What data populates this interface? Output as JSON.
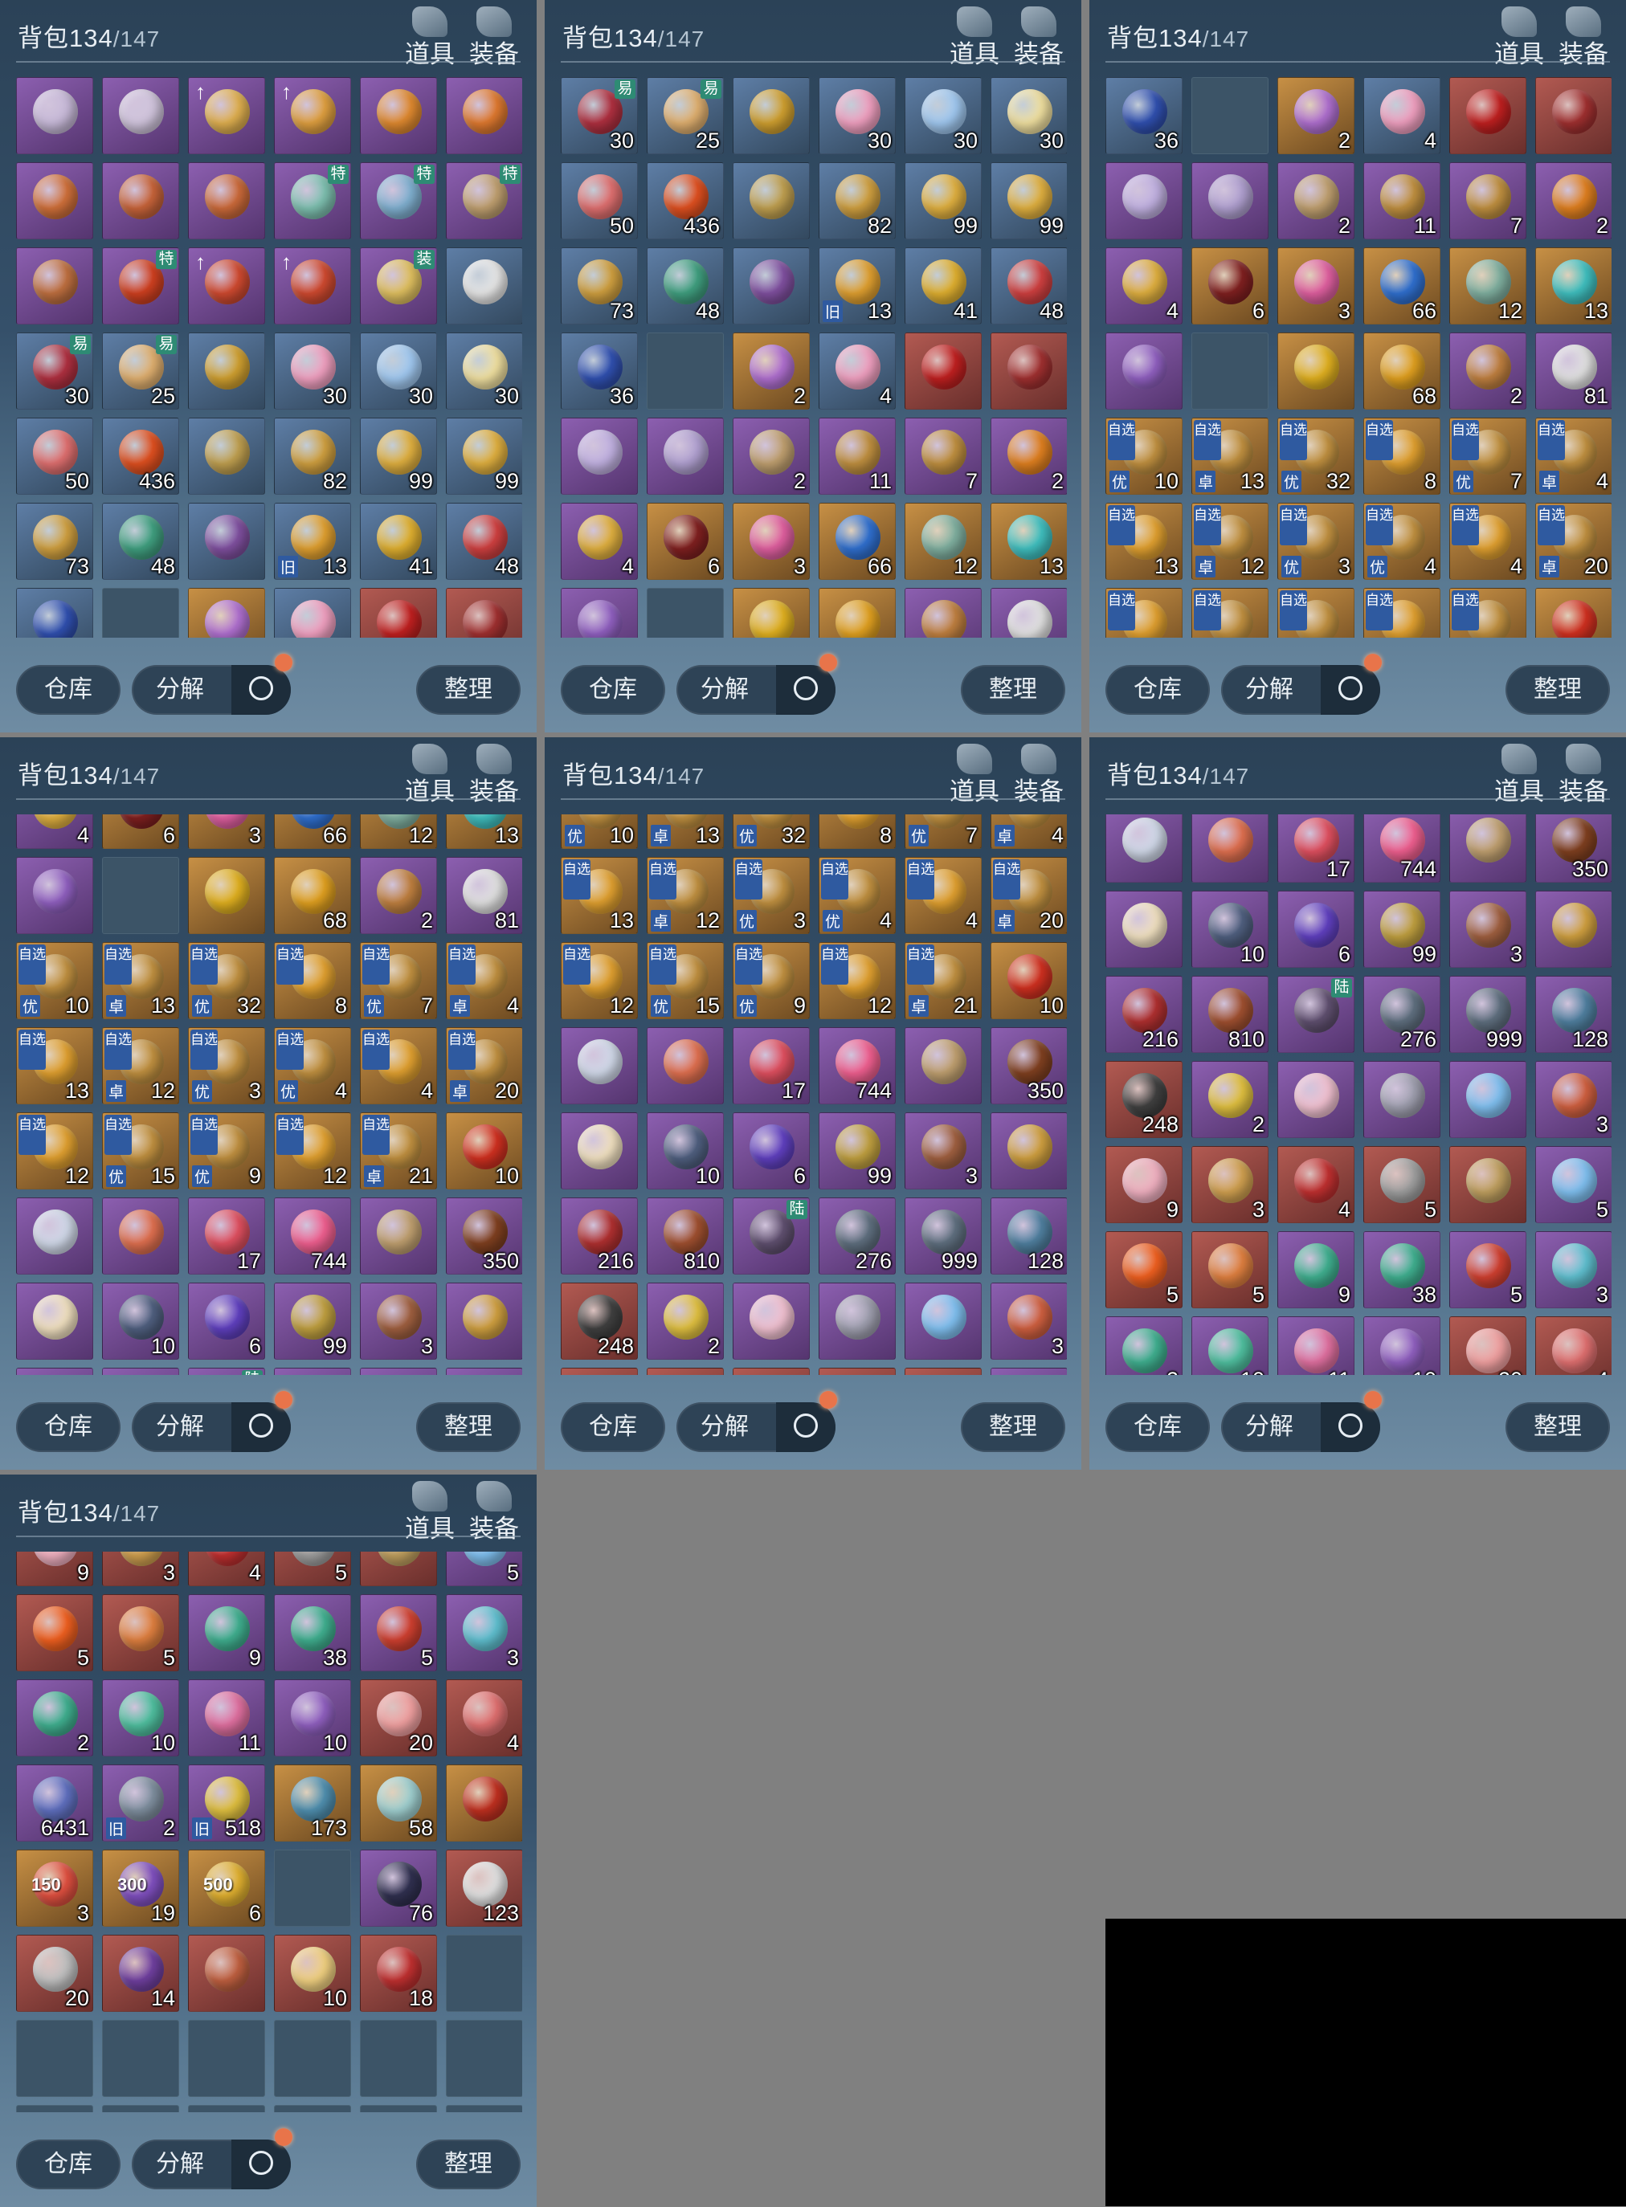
{
  "header": {
    "title": "背包",
    "count": "134",
    "capacity": "/147"
  },
  "tabs": [
    {
      "label": "道具",
      "icon": "bag-tools-icon"
    },
    {
      "label": "装备",
      "icon": "bag-equipment-icon"
    }
  ],
  "buttons": {
    "warehouse": "仓库",
    "decompose": "分解",
    "sort": "整理"
  },
  "colors": {
    "purple": "#7a4fa0",
    "gold": "#b8843e",
    "red": "#9e4a44",
    "blue": "#4c6b91",
    "empty": "#3c5467",
    "panel": "#35506a"
  },
  "inventory": [
    {
      "q": "purple",
      "c": "",
      "color": "#c7b9d8"
    },
    {
      "q": "purple",
      "c": "",
      "color": "#d0c4dc"
    },
    {
      "q": "purple",
      "c": "",
      "color": "#e0b050",
      "up": "1"
    },
    {
      "q": "purple",
      "c": "",
      "color": "#e0a040",
      "up": "1"
    },
    {
      "q": "purple",
      "c": "",
      "color": "#e08a30"
    },
    {
      "q": "purple",
      "c": "",
      "color": "#e07a30"
    },
    {
      "q": "purple",
      "c": "",
      "color": "#d0703a"
    },
    {
      "q": "purple",
      "c": "",
      "color": "#c8643a"
    },
    {
      "q": "purple",
      "c": "",
      "color": "#cc6a3a"
    },
    {
      "q": "purple",
      "c": "",
      "color": "#7ec0b0",
      "tag": "特"
    },
    {
      "q": "purple",
      "c": "",
      "color": "#80b0d0",
      "tag": "特"
    },
    {
      "q": "purple",
      "c": "",
      "color": "#c0a070",
      "tag": "特"
    },
    {
      "q": "purple",
      "c": "",
      "color": "#c07040"
    },
    {
      "q": "purple",
      "c": "",
      "color": "#d04020",
      "tag": "特"
    },
    {
      "q": "purple",
      "c": "",
      "color": "#d04a30",
      "up": "1"
    },
    {
      "q": "purple",
      "c": "",
      "color": "#d04a30",
      "up": "1"
    },
    {
      "q": "purple",
      "c": "",
      "color": "#e0c060",
      "tag": "装"
    },
    {
      "q": "blue",
      "c": "",
      "color": "#e6e6e6"
    },
    {
      "q": "blue",
      "c": "30",
      "color": "#b03040",
      "tag": "易"
    },
    {
      "q": "blue",
      "c": "25",
      "color": "#e0b070",
      "tag": "易"
    },
    {
      "q": "blue",
      "c": "",
      "color": "#d0a030"
    },
    {
      "q": "blue",
      "c": "30",
      "color": "#f0a0c0"
    },
    {
      "q": "blue",
      "c": "30",
      "color": "#a0c8f0"
    },
    {
      "q": "blue",
      "c": "30",
      "color": "#f0e0a0"
    },
    {
      "q": "blue",
      "c": "50",
      "color": "#e07070"
    },
    {
      "q": "blue",
      "c": "436",
      "color": "#e05020"
    },
    {
      "q": "blue",
      "c": "",
      "color": "#c0a050"
    },
    {
      "q": "blue",
      "c": "82",
      "color": "#d0a040"
    },
    {
      "q": "blue",
      "c": "99",
      "color": "#e0b040"
    },
    {
      "q": "blue",
      "c": "99",
      "color": "#e0b040"
    },
    {
      "q": "blue",
      "c": "73",
      "color": "#d0a040"
    },
    {
      "q": "blue",
      "c": "48",
      "color": "#40a080"
    },
    {
      "q": "blue",
      "c": "",
      "color": "#8050a0"
    },
    {
      "q": "blue",
      "c": "13",
      "color": "#e0a030",
      "tagb": "旧"
    },
    {
      "q": "blue",
      "c": "41",
      "color": "#e0b030"
    },
    {
      "q": "blue",
      "c": "48",
      "color": "#d04040"
    },
    {
      "q": "blue",
      "c": "36",
      "color": "#3050b0"
    },
    {
      "q": "empty"
    },
    {
      "q": "gold",
      "c": "2",
      "color": "#b070d0"
    },
    {
      "q": "blue",
      "c": "4",
      "color": "#f0a0c0"
    },
    {
      "q": "red",
      "c": "",
      "color": "#c02020"
    },
    {
      "q": "red",
      "c": "",
      "color": "#a03030"
    },
    {
      "q": "purple",
      "c": "",
      "color": "#c0b0e0"
    },
    {
      "q": "purple",
      "c": "",
      "color": "#b0a0d0"
    },
    {
      "q": "purple",
      "c": "2",
      "color": "#c0a070"
    },
    {
      "q": "purple",
      "c": "11",
      "color": "#c09040"
    },
    {
      "q": "purple",
      "c": "7",
      "color": "#c09040"
    },
    {
      "q": "purple",
      "c": "2",
      "color": "#e08020"
    },
    {
      "q": "purple",
      "c": "4",
      "color": "#e0b040"
    },
    {
      "q": "gold",
      "c": "6",
      "color": "#802020"
    },
    {
      "q": "gold",
      "c": "3",
      "color": "#e060a0"
    },
    {
      "q": "gold",
      "c": "66",
      "color": "#3070d0"
    },
    {
      "q": "gold",
      "c": "12",
      "color": "#80b0a0"
    },
    {
      "q": "gold",
      "c": "13",
      "color": "#40c0c0"
    },
    {
      "q": "purple",
      "c": "",
      "color": "#9060c0"
    },
    {
      "q": "empty"
    },
    {
      "q": "gold",
      "c": "",
      "color": "#e0b020"
    },
    {
      "q": "gold",
      "c": "68",
      "color": "#e0a020"
    },
    {
      "q": "purple",
      "c": "2",
      "color": "#c08040"
    },
    {
      "q": "purple",
      "c": "81",
      "color": "#e0e0e0"
    },
    {
      "q": "gold",
      "c": "10",
      "color": "#c09040",
      "tagl": "自选",
      "tagb": "优"
    },
    {
      "q": "gold",
      "c": "13",
      "color": "#c09040",
      "tagl": "自选",
      "tagb": "卓"
    },
    {
      "q": "gold",
      "c": "32",
      "color": "#c09040",
      "tagl": "自选",
      "tagb": "优"
    },
    {
      "q": "gold",
      "c": "8",
      "color": "#e0a030",
      "tagl": "自选"
    },
    {
      "q": "gold",
      "c": "7",
      "color": "#c09040",
      "tagl": "自选",
      "tagb": "优"
    },
    {
      "q": "gold",
      "c": "4",
      "color": "#c09040",
      "tagl": "自选",
      "tagb": "卓"
    },
    {
      "q": "gold",
      "c": "13",
      "color": "#e0a030",
      "tagl": "自选"
    },
    {
      "q": "gold",
      "c": "12",
      "color": "#c09040",
      "tagl": "自选",
      "tagb": "卓"
    },
    {
      "q": "gold",
      "c": "3",
      "color": "#c09040",
      "tagl": "自选",
      "tagb": "优"
    },
    {
      "q": "gold",
      "c": "4",
      "color": "#c09040",
      "tagl": "自选",
      "tagb": "优"
    },
    {
      "q": "gold",
      "c": "4",
      "color": "#e0a030",
      "tagl": "自选"
    },
    {
      "q": "gold",
      "c": "20",
      "color": "#c09040",
      "tagl": "自选",
      "tagb": "卓"
    },
    {
      "q": "gold",
      "c": "12",
      "color": "#e0a030",
      "tagl": "自选"
    },
    {
      "q": "gold",
      "c": "15",
      "color": "#c09040",
      "tagl": "自选",
      "tagb": "优"
    },
    {
      "q": "gold",
      "c": "9",
      "color": "#c09040",
      "tagl": "自选",
      "tagb": "优"
    },
    {
      "q": "gold",
      "c": "12",
      "color": "#e0a030",
      "tagl": "自选"
    },
    {
      "q": "gold",
      "c": "21",
      "color": "#c09040",
      "tagl": "自选",
      "tagb": "卓"
    },
    {
      "q": "gold",
      "c": "10",
      "color": "#d03020"
    },
    {
      "q": "purple",
      "c": "",
      "color": "#d0d8e8"
    },
    {
      "q": "purple",
      "c": "",
      "color": "#e07050"
    },
    {
      "q": "purple",
      "c": "17",
      "color": "#e05060"
    },
    {
      "q": "purple",
      "c": "744",
      "color": "#f06090"
    },
    {
      "q": "purple",
      "c": "",
      "color": "#c0a070"
    },
    {
      "q": "purple",
      "c": "350",
      "color": "#804020"
    },
    {
      "q": "purple",
      "c": "",
      "color": "#f0e0c0"
    },
    {
      "q": "purple",
      "c": "10",
      "color": "#506080"
    },
    {
      "q": "purple",
      "c": "6",
      "color": "#6040c0"
    },
    {
      "q": "purple",
      "c": "99",
      "color": "#c0a040"
    },
    {
      "q": "purple",
      "c": "3",
      "color": "#a06040"
    },
    {
      "q": "purple",
      "c": "",
      "color": "#d0a040"
    },
    {
      "q": "purple",
      "c": "216",
      "color": "#b03030"
    },
    {
      "q": "purple",
      "c": "810",
      "color": "#a05030"
    },
    {
      "q": "purple",
      "c": "",
      "color": "#605070",
      "tag": "陆"
    },
    {
      "q": "purple",
      "c": "276",
      "color": "#607080"
    },
    {
      "q": "purple",
      "c": "999",
      "color": "#607080"
    },
    {
      "q": "purple",
      "c": "128",
      "color": "#5080a0"
    },
    {
      "q": "red",
      "c": "248",
      "color": "#404040"
    },
    {
      "q": "purple",
      "c": "2",
      "color": "#e0c040"
    },
    {
      "q": "purple",
      "c": "",
      "color": "#f0c0d0"
    },
    {
      "q": "purple",
      "c": "",
      "color": "#a0a0b0"
    },
    {
      "q": "purple",
      "c": "",
      "color": "#80c0f0"
    },
    {
      "q": "purple",
      "c": "3",
      "color": "#d06040"
    },
    {
      "q": "red",
      "c": "9",
      "color": "#f0b0c0"
    },
    {
      "q": "red",
      "c": "3",
      "color": "#d0a050"
    },
    {
      "q": "red",
      "c": "4",
      "color": "#c03030"
    },
    {
      "q": "red",
      "c": "5",
      "color": "#a0a0a0"
    },
    {
      "q": "red",
      "c": "",
      "color": "#c0a060"
    },
    {
      "q": "purple",
      "c": "5",
      "color": "#80c0f0"
    },
    {
      "q": "red",
      "c": "5",
      "color": "#f06020"
    },
    {
      "q": "red",
      "c": "5",
      "color": "#e08040"
    },
    {
      "q": "purple",
      "c": "9",
      "color": "#40b090"
    },
    {
      "q": "purple",
      "c": "38",
      "color": "#40b090"
    },
    {
      "q": "purple",
      "c": "5",
      "color": "#d04030"
    },
    {
      "q": "purple",
      "c": "3",
      "color": "#60c0d0"
    },
    {
      "q": "purple",
      "c": "2",
      "color": "#40b090"
    },
    {
      "q": "purple",
      "c": "10",
      "color": "#50c0a0"
    },
    {
      "q": "purple",
      "c": "11",
      "color": "#e070a0"
    },
    {
      "q": "purple",
      "c": "10",
      "color": "#9060c0"
    },
    {
      "q": "red",
      "c": "20",
      "color": "#f0a0a0"
    },
    {
      "q": "red",
      "c": "4",
      "color": "#e07070"
    },
    {
      "q": "purple",
      "c": "6431",
      "color": "#6070c0"
    },
    {
      "q": "purple",
      "c": "2",
      "color": "#8090a0",
      "tagb": "旧"
    },
    {
      "q": "purple",
      "c": "518",
      "color": "#e0c040",
      "tagb": "旧"
    },
    {
      "q": "gold",
      "c": "173",
      "color": "#5090b0"
    },
    {
      "q": "gold",
      "c": "58",
      "color": "#a0d0d0"
    },
    {
      "q": "gold",
      "c": "",
      "color": "#c03020"
    },
    {
      "q": "gold",
      "c": "3",
      "color": "#e05040",
      "lbl": "150"
    },
    {
      "q": "gold",
      "c": "19",
      "color": "#8050c0",
      "lbl": "300"
    },
    {
      "q": "gold",
      "c": "6",
      "color": "#e0b030",
      "lbl": "500"
    },
    {
      "q": "empty"
    },
    {
      "q": "purple",
      "c": "76",
      "color": "#303050"
    },
    {
      "q": "red",
      "c": "123",
      "color": "#e0e0e0"
    },
    {
      "q": "red",
      "c": "20",
      "color": "#c0c0c0"
    },
    {
      "q": "red",
      "c": "14",
      "color": "#7040a0"
    },
    {
      "q": "red",
      "c": "",
      "color": "#c06040"
    },
    {
      "q": "red",
      "c": "10",
      "color": "#f0d080"
    },
    {
      "q": "red",
      "c": "18",
      "color": "#c03030"
    },
    {
      "q": "empty"
    }
  ],
  "add_slot": "+"
}
